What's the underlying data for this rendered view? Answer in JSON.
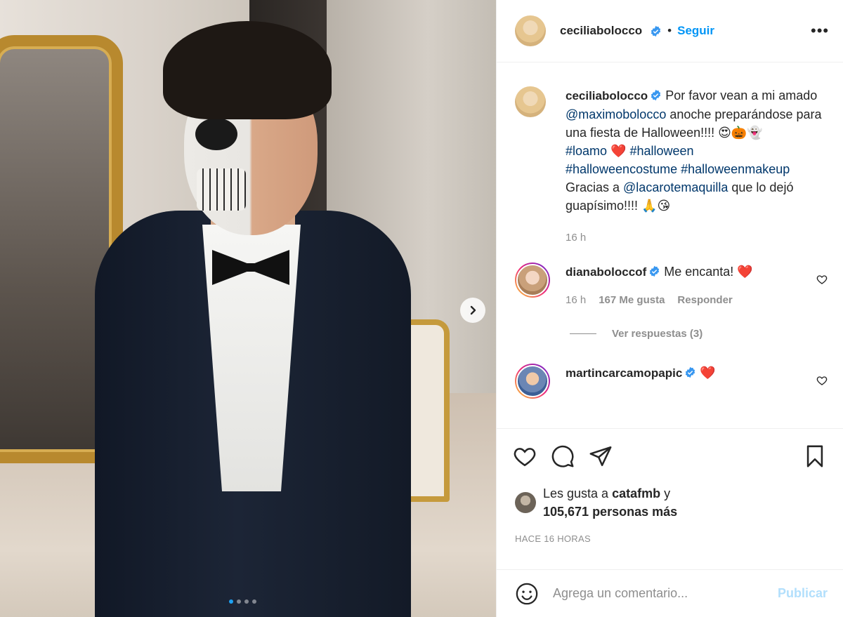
{
  "post": {
    "author": "ceciliabolocco",
    "follow_label": "Seguir",
    "separator": "•",
    "more_label": "•••",
    "media": {
      "slide_count": 4,
      "active_slide": 1
    }
  },
  "caption": {
    "author": "ceciliabolocco",
    "part1": "Por favor vean a mi amado ",
    "mention1": "@maximobolocco",
    "part2": " anoche preparándose para una fiesta de Halloween!!!! 😍🎃👻",
    "tag1": "#loamo",
    "heart": " ❤️ ",
    "tag2": "#halloween",
    "tag3": "#halloweencostume",
    "tag4": "#halloweenmakeup",
    "part3": "Gracias a ",
    "mention2": "@lacarotemaquilla",
    "part4": " que lo dejó guapísimo!!!! 🙏😘",
    "time": "16 h"
  },
  "comments": [
    {
      "author": "dianabolocco f",
      "author_display": "dianaboloccof",
      "text": "Me encanta! ❤️",
      "time": "16 h",
      "likes": "167 Me gusta",
      "reply_label": "Responder",
      "replies_label": "Ver respuestas (3)"
    },
    {
      "author_display": "martincarcamopapic",
      "text": "❤️"
    }
  ],
  "likes": {
    "prefix": "Les gusta a ",
    "first_user": "catafmb",
    "connector": " y",
    "count_text": "105,671 personas más"
  },
  "posted_ago": "HACE 16 HORAS",
  "composer": {
    "placeholder": "Agrega un comentario...",
    "publish_label": "Publicar"
  },
  "colors": {
    "link": "#00376b",
    "follow": "#0095f6",
    "muted": "#8e8e8e",
    "verified": "#3897f0",
    "heart": "#ed4956"
  }
}
